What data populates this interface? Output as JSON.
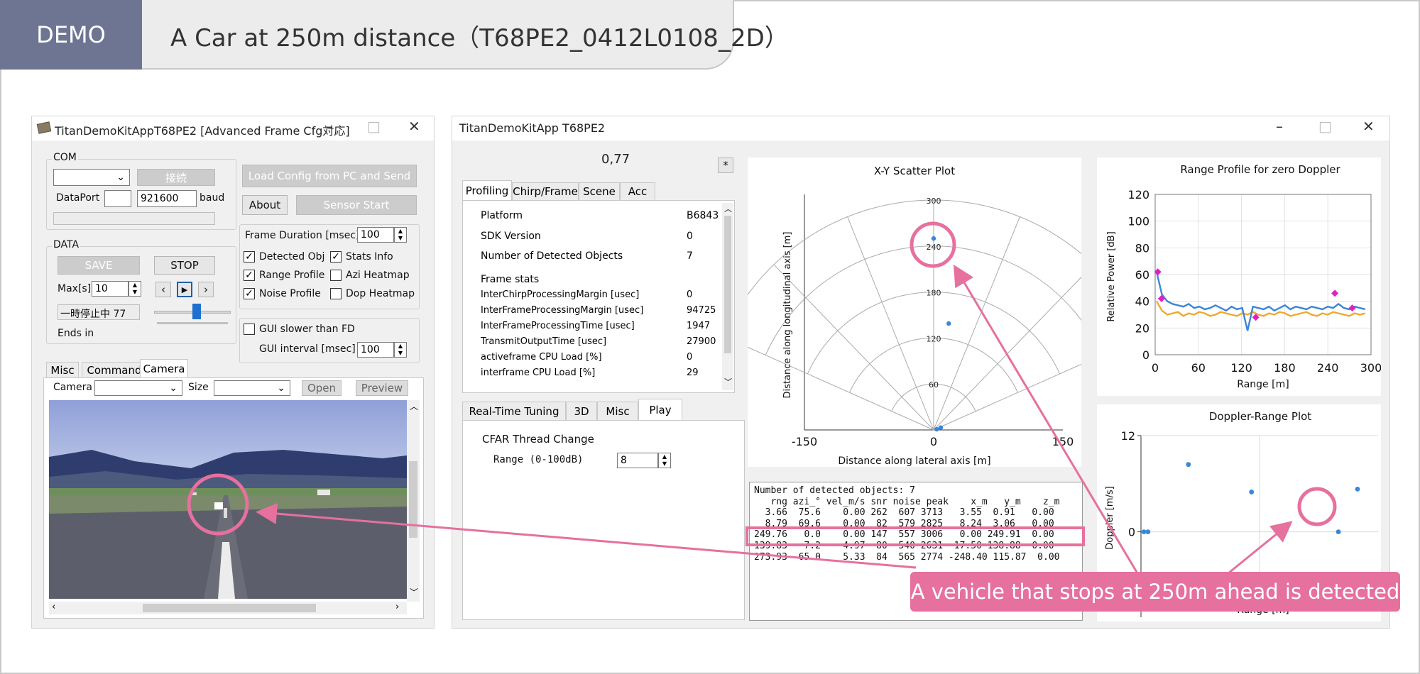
{
  "header": {
    "badge": "DEMO",
    "title": "A Car at 250m distance（T68PE2_0412L0108_2D）"
  },
  "left_window": {
    "title": "TitanDemoKitAppT68PE2 [Advanced Frame Cfg対応]",
    "com_label": "COM",
    "connect_button": "接続",
    "dataport_label": "DataPort",
    "baud_value": "921600",
    "baud_label": "baud",
    "load_config_button": "Load Config from PC and Send",
    "about_button": "About",
    "sensor_start_button": "Sensor Start",
    "data_label": "DATA",
    "save_button": "SAVE",
    "stop_button": "STOP",
    "max_label": "Max[s]",
    "max_value": "10",
    "status_text": "一時停止中 77",
    "ends_in_label": "Ends in",
    "frame_duration_label": "Frame Duration [msec]",
    "frame_duration_value": "100",
    "checks": [
      {
        "label": "Detected Obj",
        "checked": true
      },
      {
        "label": "Stats Info",
        "checked": true
      },
      {
        "label": "Range Profile",
        "checked": true
      },
      {
        "label": "Azi Heatmap",
        "checked": false
      },
      {
        "label": "Noise Profile",
        "checked": true
      },
      {
        "label": "Dop Heatmap",
        "checked": false
      }
    ],
    "gui_slower_label": "GUI slower than FD",
    "gui_interval_label": "GUI interval [msec]",
    "gui_interval_value": "100",
    "tabs": [
      "Misc",
      "Command",
      "Camera"
    ],
    "camera_label": "Camera",
    "size_label": "Size",
    "open_button": "Open",
    "preview_button": "Preview"
  },
  "right_window": {
    "title": "TitanDemoKitApp T68PE2",
    "value_display": "0,77",
    "star_button": "*",
    "tabs": [
      "Profiling",
      "Chirp/Frame",
      "Scene",
      "Acc"
    ],
    "stats": [
      {
        "label": "Platform",
        "value": "B6843"
      },
      {
        "label": "SDK Version",
        "value": "0"
      },
      {
        "label": "Number of Detected Objects",
        "value": "7"
      },
      {
        "label": "Frame stats",
        "value": ""
      },
      {
        "label": "InterChirpProcessingMargin [usec]",
        "value": "0"
      },
      {
        "label": "InterFrameProcessingMargin [usec]",
        "value": "94725"
      },
      {
        "label": "InterFrameProcessingTime [usec]",
        "value": "1947"
      },
      {
        "label": "TransmitOutputTime [usec]",
        "value": "27900"
      },
      {
        "label": "activeframe CPU Load [%]",
        "value": "0"
      },
      {
        "label": "interframe CPU Load [%]",
        "value": "29"
      }
    ],
    "bottom_tabs": [
      "Real-Time Tuning",
      "3D",
      "Misc",
      "Play"
    ],
    "cfar_label": "CFAR Thread Change",
    "range_label": "Range (0-100dB)",
    "range_value": "8",
    "detected_text": [
      "Number of detected objects: 7",
      "   rng azi_° vel_m/s snr noise peak    x_m   y_m    z_m",
      "  3.66  75.6    0.00 262  607 3713   3.55  0.91   0.00",
      "  8.79  69.6    0.00  82  579 2825   8.24  3.06   0.00",
      "249.76   0.0    0.00 147  557 3006   0.00 249.91  0.00",
      "139.83   7.2    4.97  80  540 2631  17.50 138.88  0.00",
      "273.93 -65.0    5.33  84  565 2774 -248.40 115.87  0.00"
    ]
  },
  "annotation": {
    "text": "A vehicle that stops at 250m ahead is detected",
    "color": "#e6709e"
  },
  "chart_data": [
    {
      "type": "scatter",
      "title": "X-Y Scatter Plot",
      "xlabel": "Distance along lateral axis [m]",
      "ylabel": "Distance along longitudinal axis [m]",
      "xlim": [
        -150,
        150
      ],
      "ylim": [
        0,
        300
      ],
      "x_ticks": [
        "-150",
        "0",
        "150"
      ],
      "range_rings": [
        "60",
        "120",
        "180",
        "240",
        "300"
      ],
      "points": [
        {
          "x": 3.55,
          "y": 0.91
        },
        {
          "x": 8.24,
          "y": 3.06
        },
        {
          "x": 0.0,
          "y": 249.91
        },
        {
          "x": 17.5,
          "y": 138.88
        }
      ],
      "point_color": "#3a86d8"
    },
    {
      "type": "line",
      "title": "Range Profile for zero Doppler",
      "xlabel": "Range [m]",
      "ylabel": "Relative Power [dB]",
      "xlim": [
        0,
        300
      ],
      "ylim": [
        0,
        120
      ],
      "x_ticks": [
        "0",
        "60",
        "120",
        "180",
        "240",
        "300"
      ],
      "y_ticks": [
        "0",
        "20",
        "40",
        "60",
        "80",
        "100",
        "120"
      ],
      "series": [
        {
          "color": "#3a86d8",
          "values": [
            62,
            45,
            40,
            38,
            37,
            36,
            38,
            35,
            36,
            34,
            35,
            37,
            35,
            33,
            36,
            34,
            35,
            18,
            36,
            35,
            34,
            36,
            33,
            35,
            37,
            34,
            36,
            35,
            34,
            36,
            35,
            34,
            36,
            35,
            38,
            35,
            34,
            36,
            35,
            34
          ]
        },
        {
          "color": "#f0a830",
          "values": [
            40,
            33,
            30,
            31,
            32,
            29,
            31,
            30,
            32,
            31,
            29,
            30,
            32,
            31,
            30,
            29,
            31,
            30,
            32,
            30,
            29,
            31,
            30,
            32,
            31,
            29,
            30,
            31,
            32,
            30,
            29,
            31,
            30,
            32,
            31,
            30,
            29,
            31,
            30,
            31
          ]
        }
      ],
      "markers": [
        {
          "x": 3.66,
          "y": 62
        },
        {
          "x": 8.79,
          "y": 42
        },
        {
          "x": 139.83,
          "y": 28
        },
        {
          "x": 249.76,
          "y": 46
        },
        {
          "x": 273.93,
          "y": 35
        }
      ],
      "marker_color": "#e020c0"
    },
    {
      "type": "scatter",
      "title": "Doppler-Range Plot",
      "xlabel": "Range [m]",
      "ylabel": "Doppler [m/s]",
      "xlim": [
        0,
        300
      ],
      "ylim": [
        -8,
        12
      ],
      "y_ticks": [
        "12",
        "0"
      ],
      "points": [
        {
          "x": 3.66,
          "y": 0
        },
        {
          "x": 8.79,
          "y": 0
        },
        {
          "x": 60,
          "y": 8.4
        },
        {
          "x": 139.83,
          "y": 4.97
        },
        {
          "x": 75,
          "y": -6.5
        },
        {
          "x": 249.76,
          "y": 0
        },
        {
          "x": 273.93,
          "y": 5.33
        }
      ],
      "point_color": "#3a86d8"
    }
  ]
}
